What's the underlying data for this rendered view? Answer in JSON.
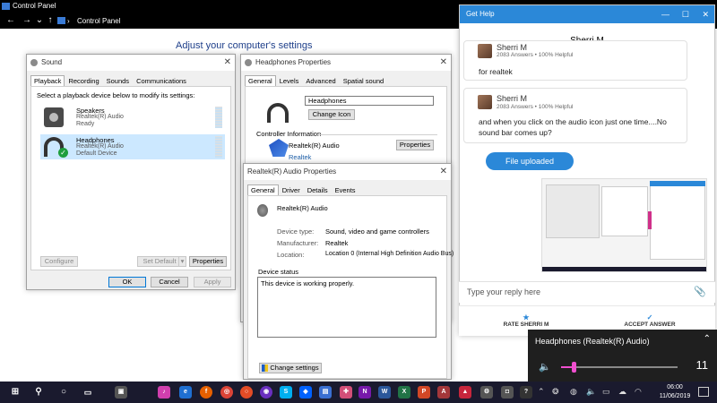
{
  "control_panel": {
    "title": "Control Panel",
    "address": "Control Panel",
    "heading": "Adjust your computer's settings",
    "nav": {
      "back": "←",
      "forward": "→",
      "dropdown": "⌄",
      "up": "↑"
    }
  },
  "sound": {
    "title": "Sound",
    "tabs": [
      "Playback",
      "Recording",
      "Sounds",
      "Communications"
    ],
    "instruction": "Select a playback device below to modify its settings:",
    "devices": [
      {
        "name": "Speakers",
        "driver": "Realtek(R) Audio",
        "status": "Ready"
      },
      {
        "name": "Headphones",
        "driver": "Realtek(R) Audio",
        "status": "Default Device"
      }
    ],
    "buttons": {
      "configure": "Configure",
      "set_default": "Set Default",
      "properties": "Properties",
      "ok": "OK",
      "cancel": "Cancel",
      "apply": "Apply"
    }
  },
  "headphones_props": {
    "title": "Headphones Properties",
    "tabs": [
      "General",
      "Levels",
      "Advanced",
      "Spatial sound"
    ],
    "name_value": "Headphones",
    "change_icon": "Change Icon",
    "controller_label": "Controller Information",
    "controller_name": "Realtek(R) Audio",
    "controller_vendor": "Realtek",
    "properties": "Properties"
  },
  "realtek_props": {
    "title": "Realtek(R) Audio Properties",
    "tabs": [
      "General",
      "Driver",
      "Details",
      "Events"
    ],
    "device_name": "Realtek(R) Audio",
    "rows": [
      {
        "label": "Device type:",
        "value": "Sound, video and game controllers"
      },
      {
        "label": "Manufacturer:",
        "value": "Realtek"
      },
      {
        "label": "Location:",
        "value": "Location 0 (Internal High Definition Audio Bus)"
      }
    ],
    "status_label": "Device status",
    "status_text": "This device is working properly.",
    "change_settings": "Change settings"
  },
  "help": {
    "title": "Get Help",
    "agent": "Sherri M",
    "messages": [
      {
        "name": "Sherri M",
        "meta": "2083 Answers • 100% Helpful",
        "text": "for realtek"
      },
      {
        "name": "Sherri M",
        "meta": "2083 Answers • 100% Helpful",
        "text": "and when you click on the audio icon just one time....No sound bar comes up?"
      }
    ],
    "upload_label": "File uploaded",
    "reply_placeholder": "Type your reply here",
    "rate": "RATE SHERRI M",
    "accept": "ACCEPT ANSWER"
  },
  "volume": {
    "device": "Headphones (Realtek(R) Audio)",
    "level": 11,
    "level_display": "11",
    "accent": "#f04fcf"
  },
  "taskbar": {
    "time": "06:00",
    "date": "11/06/2019"
  }
}
